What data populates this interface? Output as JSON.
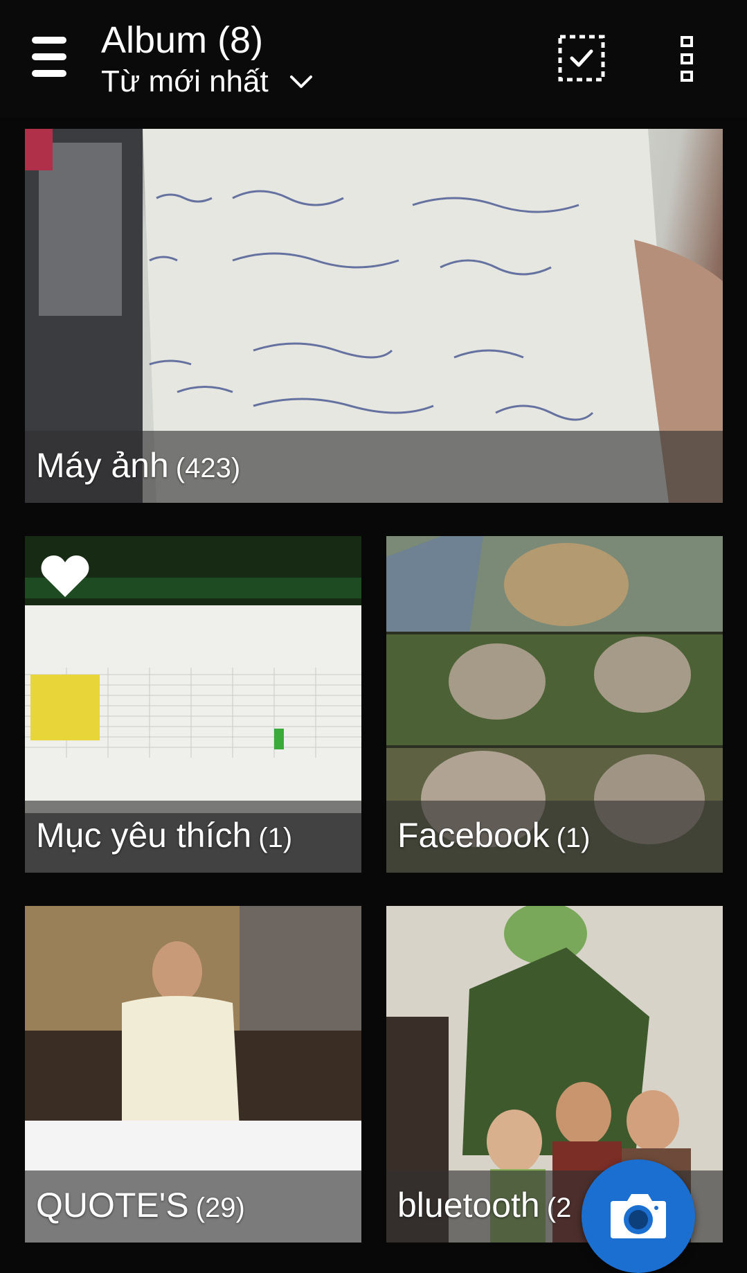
{
  "header": {
    "title": "Album (8)",
    "sort_label": "Từ mới nhất"
  },
  "albums": [
    {
      "name": "Máy ảnh",
      "count": "(423)"
    },
    {
      "name": "Mục yêu thích",
      "count": "(1)"
    },
    {
      "name": "Facebook",
      "count": "(1)"
    },
    {
      "name": "QUOTE'S",
      "count": "(29)"
    },
    {
      "name": "bluetooth",
      "count": "(2"
    }
  ],
  "icons": [
    "menu-icon",
    "chevron-down-icon",
    "select-checkbox-icon",
    "more-vert-icon",
    "heart-icon",
    "camera-icon"
  ],
  "colors": {
    "background": "#080808",
    "fab": "#1b6fd1",
    "caption_overlay": "rgba(48,48,48,0.62)"
  }
}
